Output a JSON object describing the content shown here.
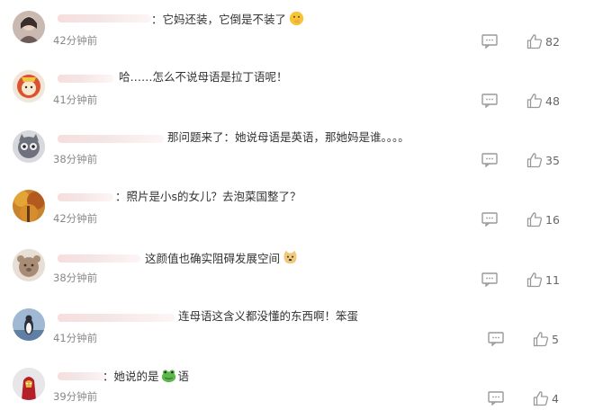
{
  "comments": [
    {
      "text": "：它妈还装，它倒是不装了",
      "emoji": "shushing-face-emoji",
      "time": "42分钟前",
      "likes": "82",
      "avatar": "avatar-girl-icon"
    },
    {
      "text": "哈……怎么不说母语是拉丁语呢！",
      "emoji": "",
      "time": "41分钟前",
      "likes": "48",
      "avatar": "avatar-cartoon-icon"
    },
    {
      "text": "那问题来了：她说母语是英语，那她妈是谁。。。。",
      "emoji": "",
      "time": "38分钟前",
      "likes": "35",
      "avatar": "avatar-cat-icon"
    },
    {
      "text": "：照片是小s的女儿？去泡菜国整了？",
      "emoji": "",
      "time": "42分钟前",
      "likes": "16",
      "avatar": "avatar-autumn-icon"
    },
    {
      "text": "这颜值也确实阻碍发展空间",
      "emoji": "doge-emoji",
      "time": "38分钟前",
      "likes": "11",
      "avatar": "avatar-animal-icon"
    },
    {
      "text": "连母语这含义都没懂的东西啊！笨蛋",
      "emoji": "",
      "time": "41分钟前",
      "likes": "5",
      "avatar": "avatar-bird-icon"
    },
    {
      "text": "：她说的是",
      "emoji": "frog-emoji",
      "text_after": "语",
      "time": "39分钟前",
      "likes": "4",
      "avatar": "avatar-hero-icon"
    }
  ],
  "colors": {
    "text": "#333333",
    "time": "#888888",
    "icon": "#999999",
    "name_blur": "#f5dede"
  }
}
